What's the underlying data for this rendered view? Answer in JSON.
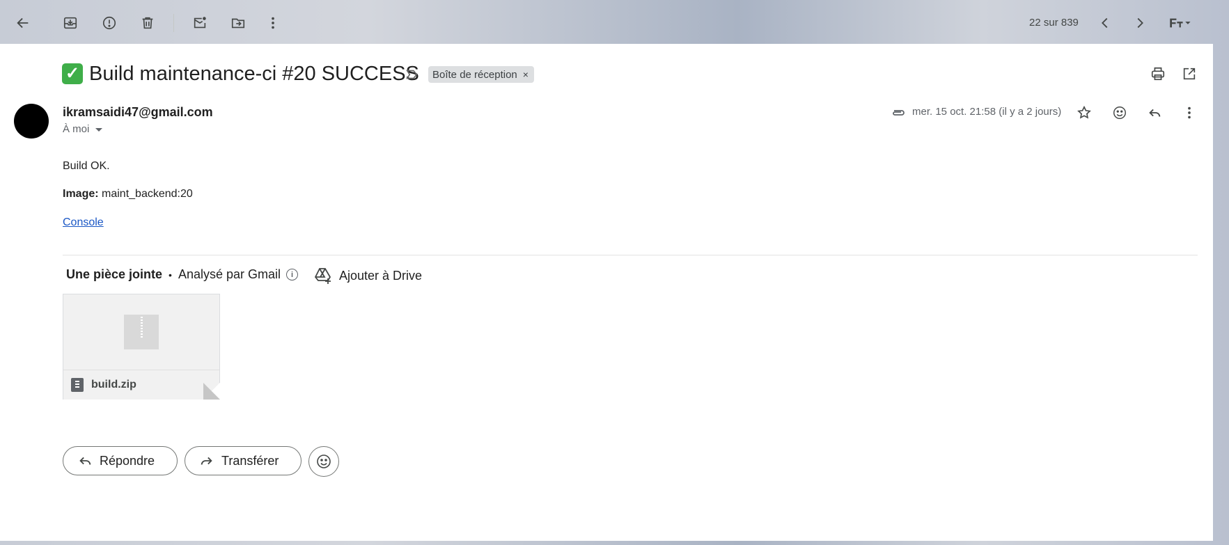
{
  "toolbar": {
    "counter": "22 sur 839"
  },
  "email": {
    "subject": "Build maintenance-ci #20 SUCCESS",
    "subject_emoji": "✓",
    "label_chip": "Boîte de réception",
    "label_chip_remove": "×",
    "sender": "ikramsaidi47@gmail.com",
    "to": "À moi",
    "date": "mer. 15 oct. 21:58 (il y a 2 jours)",
    "body": {
      "line1": "Build OK.",
      "image_label": "Image:",
      "image_value": " maint_backend:20",
      "link": "Console"
    }
  },
  "attachments": {
    "title": "Une pièce jointe",
    "dot": "•",
    "scanned": "Analysé par Gmail",
    "info": "i",
    "add_drive": "Ajouter à Drive",
    "file_name": "build.zip"
  },
  "actions": {
    "reply": "Répondre",
    "forward": "Transférer"
  },
  "colors": {
    "success_check": "#3fae49",
    "link": "#1a57c5",
    "avatar": "#000000"
  },
  "icons": [
    "back-icon",
    "archive-icon",
    "report-spam-icon",
    "delete-icon",
    "mark-unread-icon",
    "move-to-icon",
    "more-vert-icon",
    "prev-icon",
    "next-icon",
    "input-tools-icon",
    "print-icon",
    "open-new-window-icon",
    "attachment-icon",
    "star-icon",
    "emoji-icon",
    "reply-icon",
    "add-to-drive-icon",
    "zip-file-icon",
    "forward-icon"
  ]
}
